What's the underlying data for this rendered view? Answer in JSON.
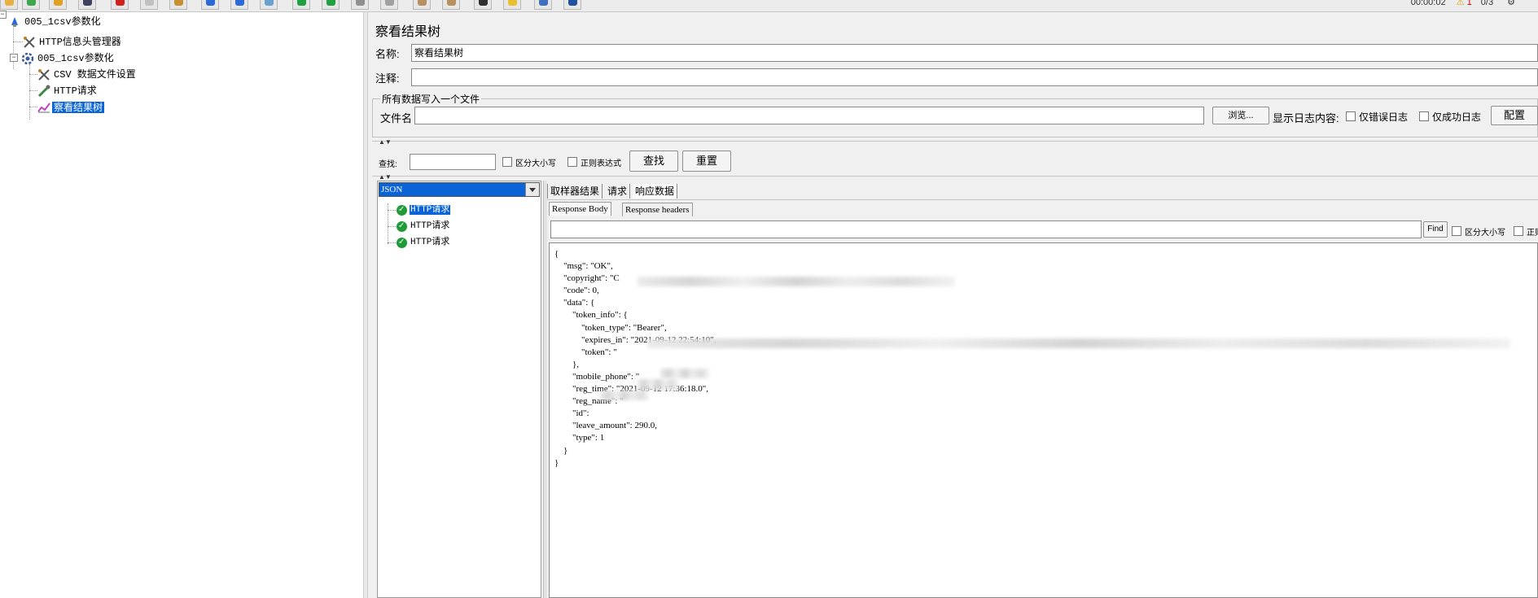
{
  "toolbar": {
    "buttons": [
      "new-icon",
      "template-icon",
      "open-icon",
      "save-icon",
      "cut-icon",
      "copy-icon",
      "paste-icon",
      "expand-icon",
      "collapse-icon",
      "toggle-icon",
      "start-icon",
      "start-no-pause-icon",
      "stop-icon",
      "shutdown-icon",
      "clear-icon",
      "clear-all-icon",
      "search-icon",
      "reset-search-icon",
      "function-helper-icon",
      "help-icon"
    ],
    "timer": "00:00:02",
    "warning_count": "1",
    "threads": "0/3"
  },
  "tree": {
    "items": [
      {
        "label": "005_1csv参数化"
      },
      {
        "label": "HTTP信息头管理器"
      },
      {
        "label": "005_1csv参数化"
      },
      {
        "label": "CSV 数据文件设置"
      },
      {
        "label": "HTTP请求"
      },
      {
        "label": "察看结果树"
      }
    ]
  },
  "panel": {
    "title": "察看结果树",
    "name_label": "名称:",
    "name_value": "察看结果树",
    "comment_label": "注释:",
    "comment_value": "",
    "file_group_legend": "所有数据写入一个文件",
    "file_label": "文件名",
    "file_value": "",
    "browse_label": "浏览...",
    "log_content_label": "显示日志内容:",
    "errors_only_label": "仅错误日志",
    "success_only_label": "仅成功日志",
    "configure_label": "配置"
  },
  "search": {
    "label": "查找:",
    "value": "",
    "case_label": "区分大小写",
    "regex_label": "正则表达式",
    "find_label": "查找",
    "reset_label": "重置"
  },
  "results": {
    "renderer": "JSON",
    "samples": [
      "HTTP请求",
      "HTTP请求",
      "HTTP请求"
    ],
    "tabs": [
      "取样器结果",
      "请求",
      "响应数据"
    ],
    "subtabs": [
      "Response Body",
      "Response headers"
    ],
    "find_button": "Find",
    "find_case_label": "区分大小写",
    "find_regex_label": "正则表达式",
    "json_lines": [
      "{",
      "    \"msg\": \"OK\",",
      "    \"copyright\": \"C",
      "    \"code\": 0,",
      "    \"data\": {",
      "        \"token_info\": {",
      "            \"token_type\": \"Bearer\",",
      "            \"expires_in\": \"2021-09-12 22:54:10\",",
      "            \"token\": \"",
      "        },",
      "        \"mobile_phone\": \"",
      "        \"reg_time\": \"2021-09-12 17:36:18.0\",",
      "        \"reg_name\": \"",
      "        \"id\": ",
      "        \"leave_amount\": 290.0,",
      "        \"type\": 1",
      "    }",
      "}"
    ]
  }
}
